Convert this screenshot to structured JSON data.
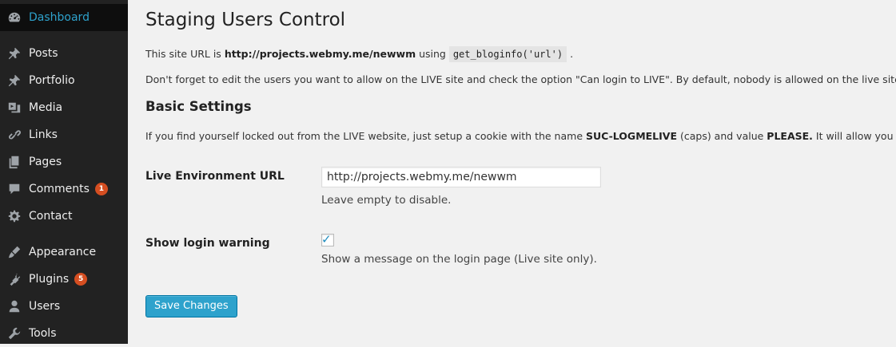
{
  "sidebar": {
    "items": [
      {
        "label": "Dashboard",
        "icon": "dashboard-icon",
        "active": true
      },
      {
        "label": "Posts",
        "icon": "pin-icon"
      },
      {
        "label": "Portfolio",
        "icon": "pin-icon"
      },
      {
        "label": "Media",
        "icon": "media-icon"
      },
      {
        "label": "Links",
        "icon": "link-icon"
      },
      {
        "label": "Pages",
        "icon": "pages-icon"
      },
      {
        "label": "Comments",
        "icon": "comment-icon",
        "badge": "1"
      },
      {
        "label": "Contact",
        "icon": "gear-icon"
      },
      {
        "label": "Appearance",
        "icon": "brush-icon"
      },
      {
        "label": "Plugins",
        "icon": "plugin-icon",
        "badge": "5"
      },
      {
        "label": "Users",
        "icon": "user-icon"
      },
      {
        "label": "Tools",
        "icon": "wrench-icon"
      }
    ]
  },
  "page": {
    "title": "Staging Users Control",
    "intro_prefix": "This site URL is ",
    "intro_url": "http://projects.webmy.me/newwm",
    "intro_mid": " using ",
    "intro_code": "get_bloginfo('url')",
    "intro_suffix": " .",
    "notice": "Don't forget to edit the users you want to allow on the LIVE site and check the option \"Can login to LIVE\". By default, nobody is allowed on the live site.",
    "section_title": "Basic Settings",
    "cookie_prefix": "If you find yourself locked out from the LIVE website, just setup a cookie with the name ",
    "cookie_name": "SUC-LOGMELIVE",
    "cookie_mid": " (caps) and value ",
    "cookie_value": "PLEASE.",
    "cookie_suffix": " It will allow you to login."
  },
  "form": {
    "live_url_label": "Live Environment URL",
    "live_url_value": "http://projects.webmy.me/newwm",
    "live_url_desc": "Leave empty to disable.",
    "login_warning_label": "Show login warning",
    "login_warning_checked": true,
    "login_warning_desc": "Show a message on the login page (Live site only).",
    "save_label": "Save Changes"
  },
  "colors": {
    "sidebar_bg": "#222222",
    "active_text": "#2ea2cc",
    "badge": "#d54e21",
    "button": "#2ea2cc"
  }
}
